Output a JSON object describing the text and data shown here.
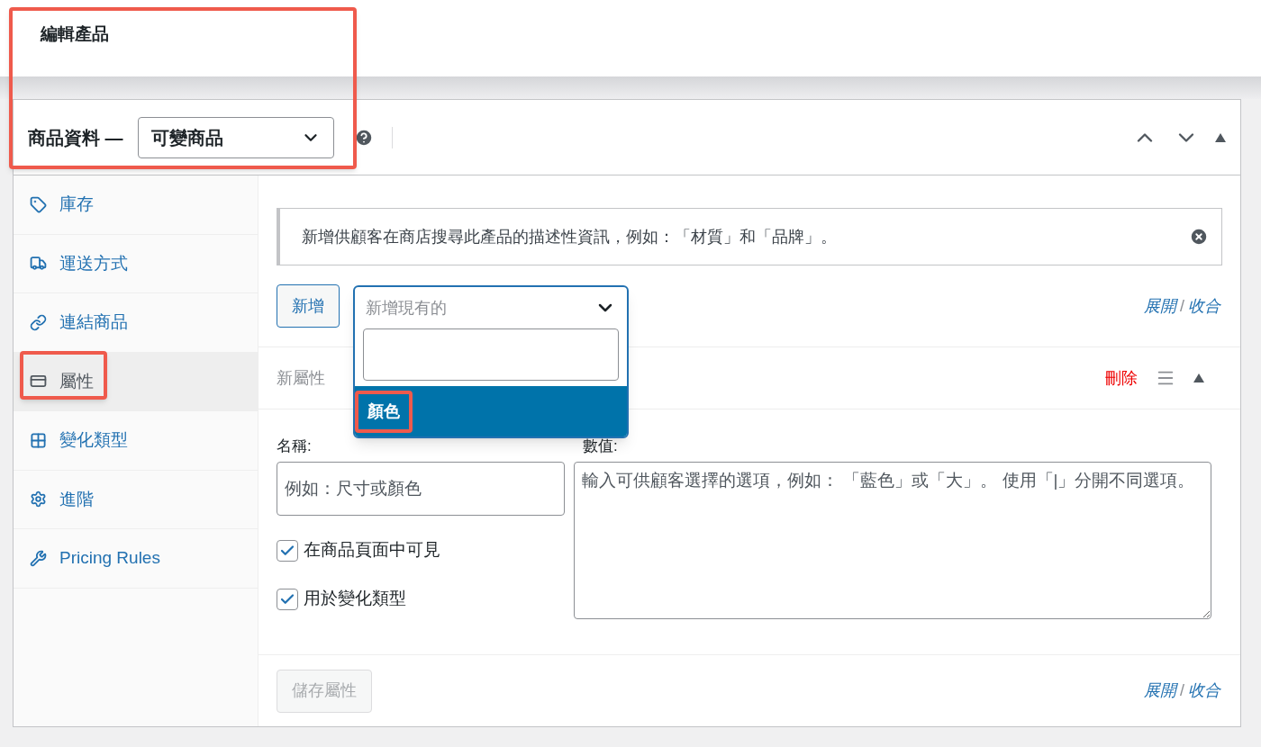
{
  "page": {
    "title": "編輯產品"
  },
  "product_data": {
    "label": "商品資料 —",
    "type_select": {
      "value": "可變商品"
    }
  },
  "tabs": [
    {
      "label": "庫存",
      "selected": false
    },
    {
      "label": "運送方式",
      "selected": false
    },
    {
      "label": "連結商品",
      "selected": false
    },
    {
      "label": "屬性",
      "selected": true
    },
    {
      "label": "變化類型",
      "selected": false
    },
    {
      "label": "進階",
      "selected": false
    },
    {
      "label": "Pricing Rules",
      "selected": false
    }
  ],
  "notice": {
    "text": "新增供顧客在商店搜尋此產品的描述性資訊，例如：「材質」和「品牌」。"
  },
  "toolbar": {
    "add_button": "新增",
    "attribute_select": {
      "placeholder": "新增現有的",
      "options": [
        {
          "label": "顏色",
          "selected": true
        }
      ]
    },
    "expand": "展開",
    "separator": "/",
    "collapse": "收合"
  },
  "attribute": {
    "title": "新屬性",
    "remove": "刪除",
    "name_label": "名稱:",
    "name_field": {
      "placeholder": "例如：尺寸或顏色"
    },
    "values_label": "數值:",
    "values_field": {
      "placeholder": "輸入可供顧客選擇的選項，例如： 「藍色」或「大」。 使用「|」分開不同選項。"
    },
    "checkboxes": [
      {
        "label": "在商品頁面中可見",
        "checked": true
      },
      {
        "label": "用於變化類型",
        "checked": true
      }
    ]
  },
  "footer": {
    "save_button": {
      "label": "儲存屬性",
      "disabled": true
    },
    "expand": "展開",
    "separator": "/",
    "collapse": "收合"
  }
}
